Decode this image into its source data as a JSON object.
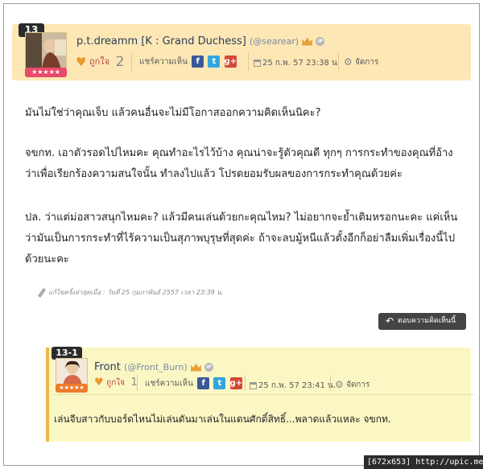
{
  "post": {
    "number": "13",
    "username": "p.t.dreamm [K : Grand Duchess]",
    "handle": "(@searear)",
    "like_label": "ถูกใจ",
    "like_count": "2",
    "share_label": "แชร์ความเห็น",
    "date": "25 ก.พ. 57 23:38 น.",
    "manage_label": "จัดการ",
    "stars": "★★★★★",
    "paragraphs": [
      "มันไม่ใช่ว่าคุณเจ็บ แล้วคนอื่นจะไม่มีโอกาสออกความคิดเห็นนิคะ?",
      "จขกท. เอาตัวรอดไปไหมคะ คุณทำอะไรไว้บ้าง คุณน่าจะรู้ตัวคุณดี ทุกๆ การกระทำของคุณที่อ้างว่าเพื่อเรียกร้องความสนใจนั้น ทำลงไปแล้ว โปรดยอมรับผลของการกระทำคุณด้วยค่ะ",
      "ปล. ว่าแต่ม่อสาวสนุกไหมคะ? แล้วมีคนเล่นด้วยกะคุณไหม? ไม่อยากจะย้ำเติมหรอกนะคะ แค่เห็นว่ามันเป็นการกระทำที่ไร้ความเป็นสุภาพบุรุษที่สุดค่ะ ถ้าจะลบมู้หนีแล้วตั้งอีกก็อย่าลืมเพิ่มเรื่องนี้ไปด้วยนะคะ"
    ],
    "edit_note": "แก้ไขครั้งล่าสุดเมื่อ : วันที่ 25 กุมภาพันธ์ 2557 เวลา 23:39 น.",
    "reply_button": "ตอบความคิดเห็นนี้"
  },
  "reply": {
    "number": "13-1",
    "username": "Front",
    "handle": "(@Front_Burn)",
    "like_label": "ถูกใจ",
    "like_count": "1",
    "share_label": "แชร์ความเห็น",
    "date": "25 ก.พ. 57 23:41 น.",
    "manage_label": "จัดการ",
    "stars": "★★★★★",
    "text": "เล่นจีบสาวกับบอร์ดไหนไม่เล่นดันมาเล่นในแดนศักดิ์สิทธิ์...พลาดแล้วแหละ จขกท."
  },
  "icons": {
    "facebook": "f",
    "twitter": "t",
    "googleplus": "g+",
    "ip": "IP"
  },
  "watermark": "[672x653] http://upic.me/",
  "colors": {
    "header_bg": "#fde7b5",
    "reply_bg": "#fbf7c4",
    "reply_border": "#f0b74a",
    "stars_bg": "#e84a6a"
  }
}
